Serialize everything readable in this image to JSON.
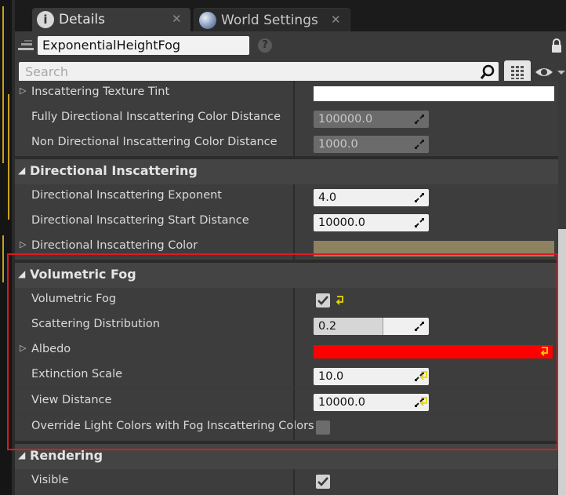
{
  "tabs": [
    {
      "label": "Details",
      "icon": "info-icon"
    },
    {
      "label": "World Settings",
      "icon": "globe-icon"
    }
  ],
  "header": {
    "actor_name": "ExponentialHeightFog",
    "search_placeholder": "Search"
  },
  "rows": {
    "inscattering_texture_tint": {
      "label": "Inscattering Texture Tint",
      "color": "#ffffff"
    },
    "fully_directional_distance": {
      "label": "Fully Directional Inscattering Color Distance",
      "value": "100000.0"
    },
    "non_directional_distance": {
      "label": "Non Directional Inscattering Color Distance",
      "value": "1000.0"
    },
    "directional_exponent": {
      "label": "Directional Inscattering Exponent",
      "value": "4.0"
    },
    "directional_start_distance": {
      "label": "Directional Inscattering Start Distance",
      "value": "10000.0"
    },
    "directional_color": {
      "label": "Directional Inscattering Color",
      "color": "#8c8260"
    },
    "volumetric_fog": {
      "label": "Volumetric Fog",
      "checked": true
    },
    "scattering_distribution": {
      "label": "Scattering Distribution",
      "value": "0.2",
      "fraction": 0.6
    },
    "albedo": {
      "label": "Albedo",
      "color": "#ff0000"
    },
    "extinction_scale": {
      "label": "Extinction Scale",
      "value": "10.0"
    },
    "view_distance": {
      "label": "View Distance",
      "value": "10000.0"
    },
    "override_light_colors": {
      "label": "Override Light Colors with Fog Inscattering Colors",
      "checked": false
    },
    "visible": {
      "label": "Visible",
      "checked": true
    }
  },
  "categories": {
    "directional_inscattering": "Directional Inscattering",
    "volumetric_fog": "Volumetric Fog",
    "rendering": "Rendering"
  },
  "colors": {
    "highlight_box": "#e0181f",
    "reset_arrow": "#e8d800"
  }
}
